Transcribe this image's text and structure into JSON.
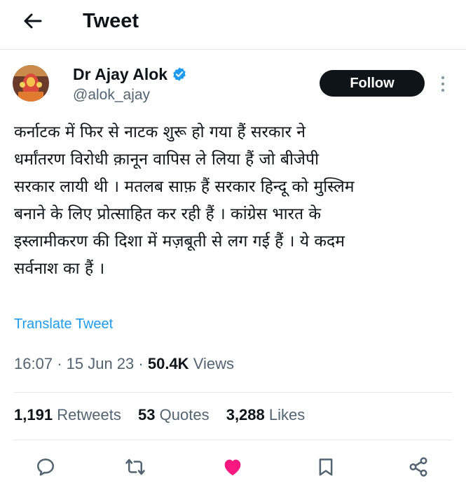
{
  "header": {
    "title": "Tweet",
    "back_icon": "arrow-left-icon"
  },
  "author": {
    "name": "Dr Ajay Alok",
    "handle": "@alok_ajay",
    "verified_color": "#1d9bf0"
  },
  "follow_label": "Follow",
  "tweet": {
    "lines": [
      "कर्नाटक में फिर से नाटक शुरू हो गया हैं सरकार ने",
      "धर्मांतरण विरोधी क़ानून वापिस ले लिया हैं जो बीजेपी",
      "सरकार लायी थी । मतलब साफ़ हैं सरकार हिन्दू को मुस्लिम",
      "बनाने के लिए प्रोत्साहित कर रही हैं । कांग्रेस भारत के",
      "इस्लामीकरण की दिशा में मज़बूती से लग गई हैं । ये कदम",
      "सर्वनाश का हैं ।"
    ],
    "translate_label": "Translate Tweet"
  },
  "meta": {
    "time": "16:07",
    "date": "15 Jun 23",
    "views_count": "50.4K",
    "views_label": "Views"
  },
  "stats": {
    "retweets_count": "1,191",
    "retweets_label": "Retweets",
    "quotes_count": "53",
    "quotes_label": "Quotes",
    "likes_count": "3,288",
    "likes_label": "Likes"
  },
  "actions": {
    "reply_icon": "reply-icon",
    "retweet_icon": "retweet-icon",
    "like_icon": "heart-icon",
    "like_color": "#f91880",
    "bookmark_icon": "bookmark-icon",
    "share_icon": "share-icon"
  },
  "colors": {
    "accent": "#1d9bf0",
    "text": "#0f1419",
    "muted": "#536471"
  }
}
